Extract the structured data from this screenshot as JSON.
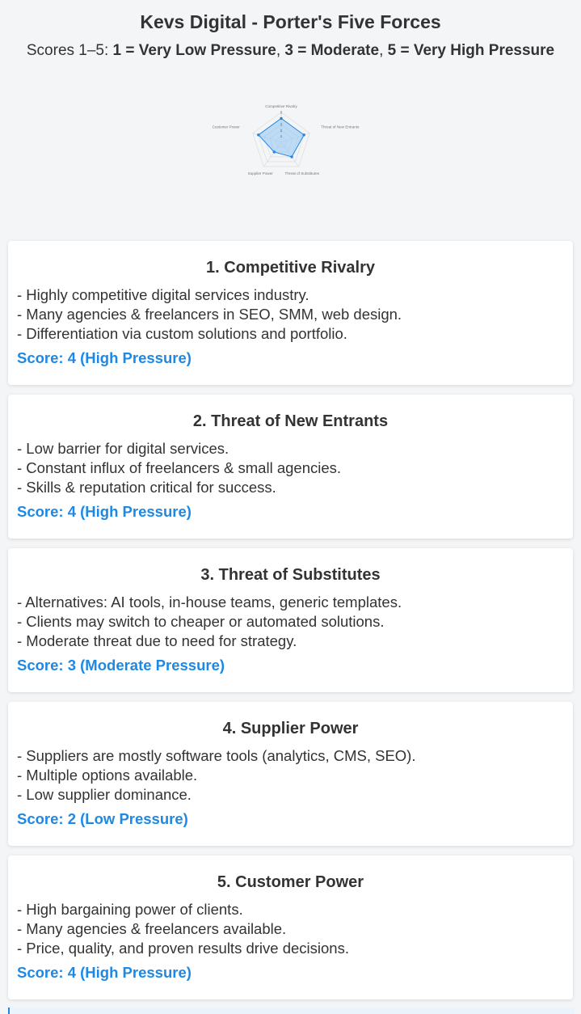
{
  "header": {
    "title": "Kevs Digital - Porter's Five Forces",
    "subtitle_prefix": "Scores 1–5: ",
    "scale_low": "1 = Very Low Pressure",
    "scale_mid": "3 = Moderate",
    "scale_high": "5 = Very High Pressure",
    "sep1": ", ",
    "sep2": ", "
  },
  "chart_data": {
    "type": "radar",
    "categories": [
      "Competitive Rivalry",
      "Threat of New Entrants",
      "Threat of Substitutes",
      "Supplier Power",
      "Customer Power"
    ],
    "values": [
      4,
      4,
      3,
      2,
      4
    ],
    "rlim": [
      0,
      5
    ],
    "tick_labels": [
      "1",
      "2",
      "3",
      "4",
      "5"
    ],
    "colors": {
      "line": "#1e88e5",
      "fill": "#90c4f3",
      "grid": "#d9d9d9"
    }
  },
  "cards": [
    {
      "heading": "1. Competitive Rivalry",
      "lines": [
        "- Highly competitive digital services industry.",
        "- Many agencies & freelancers in SEO, SMM, web design.",
        "- Differentiation via custom solutions and portfolio."
      ],
      "score": "Score: 4 (High Pressure)"
    },
    {
      "heading": "2. Threat of New Entrants",
      "lines": [
        "- Low barrier for digital services.",
        "- Constant influx of freelancers & small agencies.",
        "- Skills & reputation critical for success."
      ],
      "score": "Score: 4 (High Pressure)"
    },
    {
      "heading": "3. Threat of Substitutes",
      "lines": [
        "- Alternatives: AI tools, in-house teams, generic templates.",
        "- Clients may switch to cheaper or automated solutions.",
        "- Moderate threat due to need for strategy."
      ],
      "score": "Score: 3 (Moderate Pressure)"
    },
    {
      "heading": "4. Supplier Power",
      "lines": [
        "- Suppliers are mostly software tools (analytics, CMS, SEO).",
        "- Multiple options available.",
        "- Low supplier dominance."
      ],
      "score": "Score: 2 (Low Pressure)"
    },
    {
      "heading": "5. Customer Power",
      "lines": [
        "- High bargaining power of clients.",
        "- Many agencies & freelancers available.",
        "- Price, quality, and proven results drive decisions."
      ],
      "score": "Score: 4 (High Pressure)"
    }
  ]
}
